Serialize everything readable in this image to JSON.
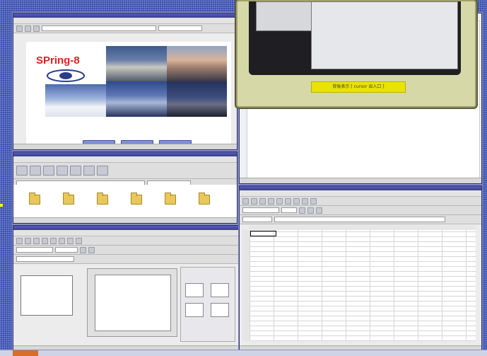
{
  "browser": {
    "logo_text": "SPring-8",
    "buttons": [
      "",
      "",
      ""
    ]
  },
  "camera": {
    "caption": "背後表示 [ cursor 出入口 ]"
  },
  "colors": {
    "desktop": "#3a4fb0",
    "titlebar": "#3a3f8f",
    "camera_frame": "#d6d8a8",
    "caption_bg": "#e9e300"
  },
  "icons": {
    "folders": [
      "folder-icon",
      "folder-icon",
      "folder-icon",
      "folder-icon",
      "folder-icon",
      "folder-icon"
    ]
  }
}
